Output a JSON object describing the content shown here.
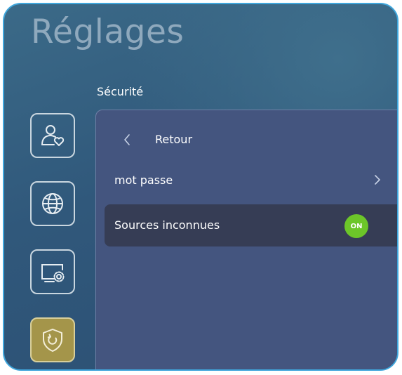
{
  "header": {
    "title": "Réglages"
  },
  "section": {
    "title": "Sécurité"
  },
  "sidebar": {
    "items": [
      {
        "icon": "user-heart-icon"
      },
      {
        "icon": "globe-icon"
      },
      {
        "icon": "screen-settings-icon"
      },
      {
        "icon": "shield-icon",
        "active": true
      }
    ]
  },
  "panel": {
    "back_label": "Retour",
    "rows": [
      {
        "label": "mot passe"
      },
      {
        "label": "Sources inconnues",
        "toggle": "ON"
      }
    ]
  },
  "colors": {
    "accent": "#3fa6dc",
    "active_nav": "#a4954a",
    "toggle_on": "#6cc629",
    "panel": "#44557f"
  }
}
